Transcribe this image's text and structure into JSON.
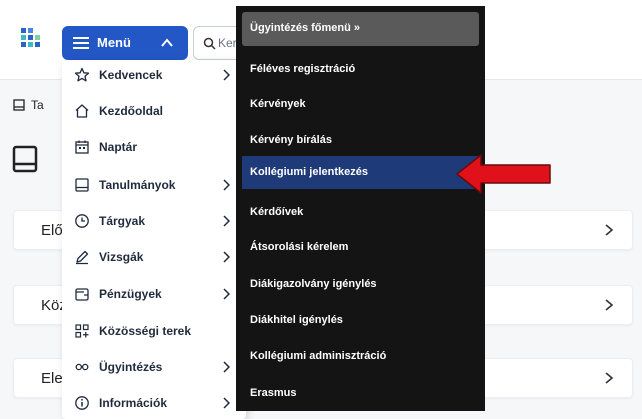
{
  "header": {
    "menu_label": "Menü",
    "search_placeholder": "Keresés"
  },
  "breadcrumb": {
    "text": "Ta"
  },
  "cards": [
    {
      "title": "Elő"
    },
    {
      "title": "Köz"
    },
    {
      "title": "Ele"
    }
  ],
  "left_menu": {
    "items": [
      {
        "label": "Kedvencek",
        "icon": "star-icon",
        "has_submenu": true
      },
      {
        "label": "Kezdőoldal",
        "icon": "home-icon",
        "has_submenu": false
      },
      {
        "label": "Naptár",
        "icon": "calendar-icon",
        "has_submenu": false
      },
      {
        "label": "Tanulmányok",
        "icon": "book-icon",
        "has_submenu": true
      },
      {
        "label": "Tárgyak",
        "icon": "clock-icon",
        "has_submenu": true
      },
      {
        "label": "Vizsgák",
        "icon": "pencil-icon",
        "has_submenu": true
      },
      {
        "label": "Pénzügyek",
        "icon": "wallet-icon",
        "has_submenu": true
      },
      {
        "label": "Közösségi terek",
        "icon": "grid-plus-icon",
        "has_submenu": false
      },
      {
        "label": "Ügyintézés",
        "icon": "infinity-icon",
        "has_submenu": true
      },
      {
        "label": "Információk",
        "icon": "info-icon",
        "has_submenu": true
      }
    ]
  },
  "submenu": {
    "header": "Ügyintézés főmenü »",
    "items": [
      {
        "label": "Féléves regisztráció"
      },
      {
        "label": "Kérvények"
      },
      {
        "label": "Kérvény bírálás"
      },
      {
        "label": "Kollégiumi jelentkezés",
        "highlighted": true
      },
      {
        "label": "Kérdőívek"
      },
      {
        "label": "Átsorolási kérelem"
      },
      {
        "label": "Diákigazolvány igénylés"
      },
      {
        "label": "Diákhitel igénylés"
      },
      {
        "label": "Kollégiumi adminisztráció"
      },
      {
        "label": "Erasmus"
      }
    ]
  },
  "colors": {
    "menu_button": "#2357c6",
    "submenu_bg": "#141414",
    "submenu_active": "#1e3a78",
    "arrow": "#e0111b"
  }
}
